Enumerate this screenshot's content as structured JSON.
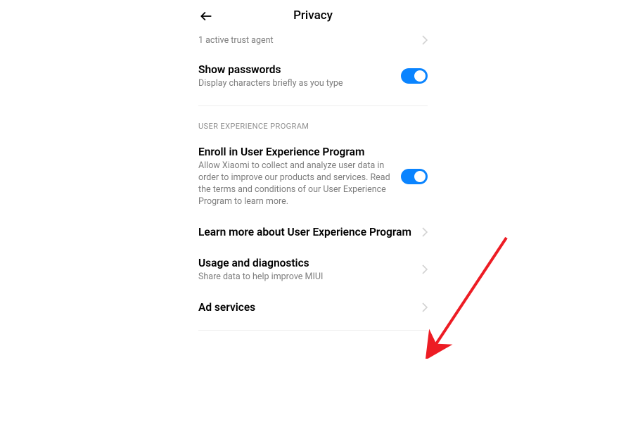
{
  "header": {
    "title": "Privacy"
  },
  "trust": {
    "sub": "1 active trust agent"
  },
  "show_passwords": {
    "title": "Show passwords",
    "sub": "Display characters briefly as you type",
    "on": true
  },
  "section_uep": "USER EXPERIENCE PROGRAM",
  "enroll": {
    "title": "Enroll in User Experience Program",
    "sub": "Allow Xiaomi to collect and analyze user data in order to improve our products and services. Read the terms and conditions of our User Experience Program to learn more.",
    "on": true
  },
  "learn_more": {
    "title": "Learn more about User Experience Program"
  },
  "usage": {
    "title": "Usage and diagnostics",
    "sub": "Share data to help improve MIUI"
  },
  "ad": {
    "title": "Ad services"
  },
  "colors": {
    "accent": "#0a84ff",
    "arrow": "#ed1c24"
  }
}
